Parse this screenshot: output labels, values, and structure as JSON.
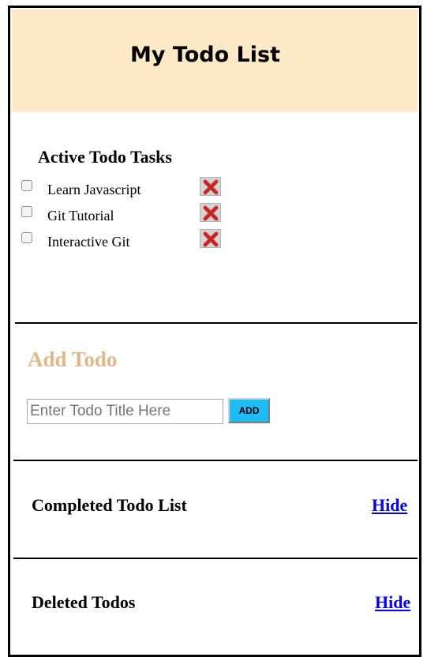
{
  "header": {
    "title": "My Todo List",
    "background": "#fde8c8"
  },
  "active": {
    "heading": "Active Todo Tasks",
    "tasks": [
      {
        "label": "Learn Javascript",
        "checked": false
      },
      {
        "label": "Git Tutorial",
        "checked": false
      },
      {
        "label": "Interactive Git",
        "checked": false
      }
    ],
    "delete_icon": "close-icon"
  },
  "add": {
    "heading": "Add Todo",
    "heading_color": "#dfb889",
    "input_value": "",
    "input_placeholder": "Enter Todo Title Here",
    "button_label": "ADD",
    "button_color": "#1ebcf5"
  },
  "completed": {
    "heading": "Completed Todo List",
    "toggle_label": "Hide"
  },
  "deleted": {
    "heading": "Deleted Todos",
    "toggle_label": "Hide"
  },
  "link_color": "#0000ee"
}
